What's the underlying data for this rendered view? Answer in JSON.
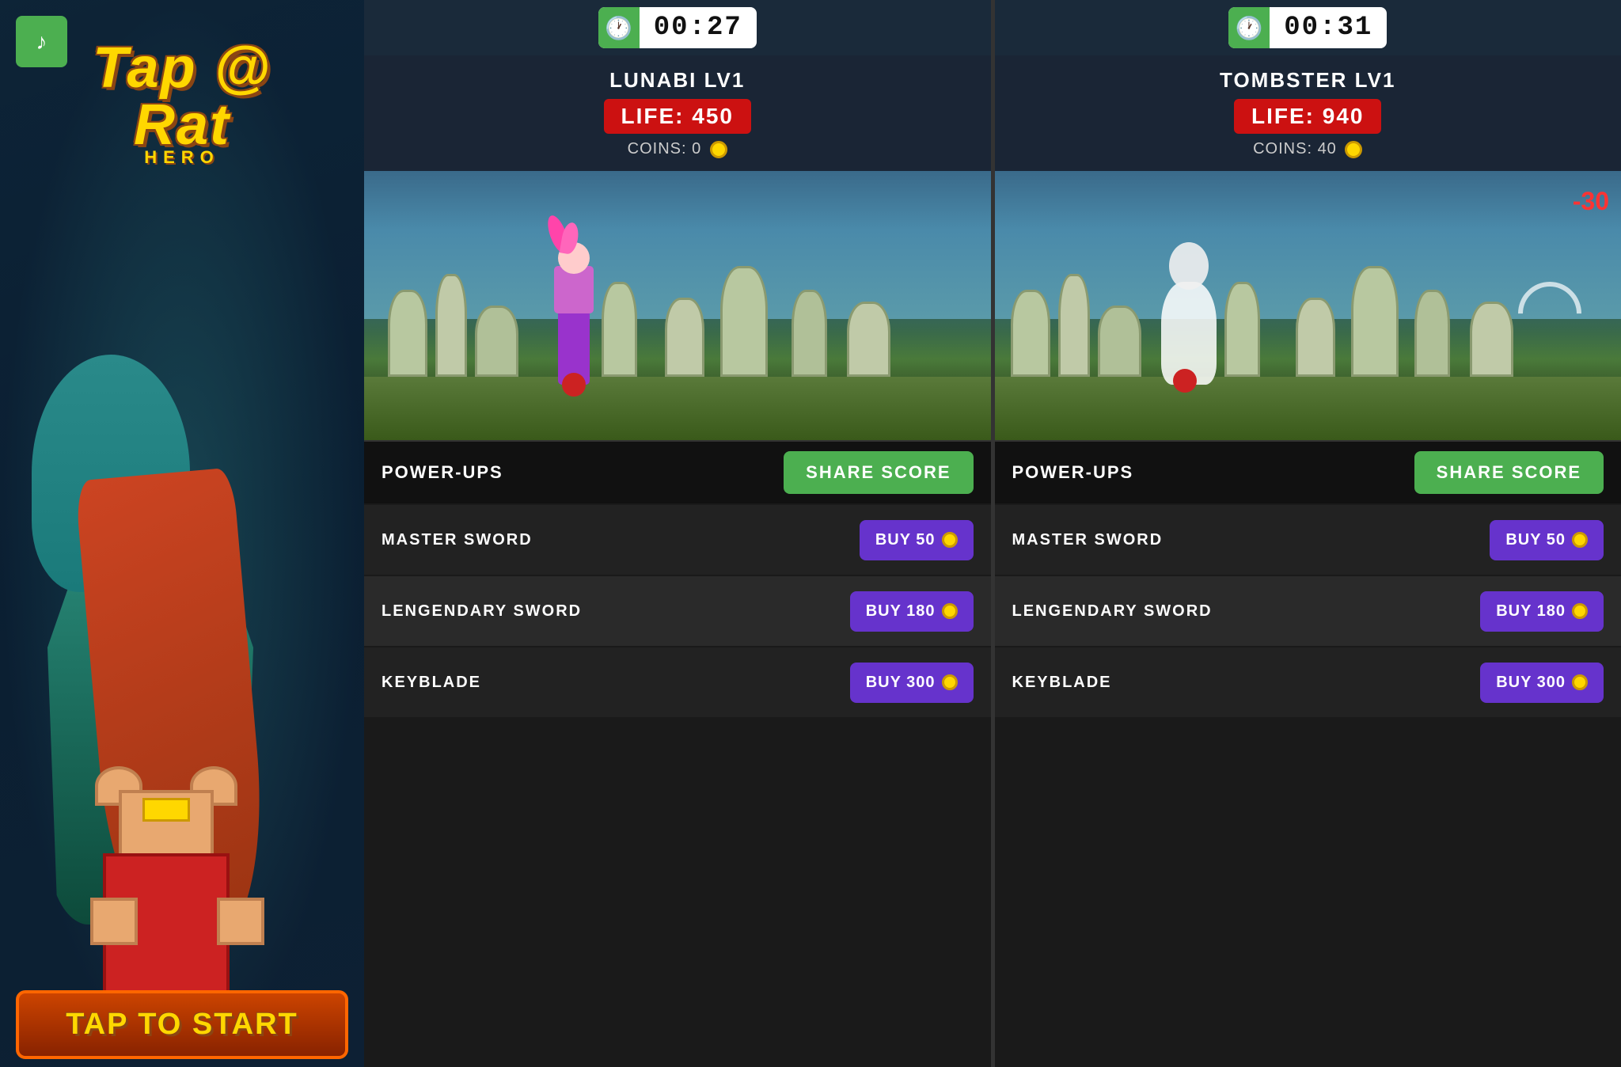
{
  "left": {
    "music_icon": "♪",
    "logo": "Tap @ Rat",
    "logo_subtitle": "HERO",
    "tap_to_start": "TAP TO START"
  },
  "panel1": {
    "timer": "00:27",
    "player_name": "LUNABI LV1",
    "life_label": "LIFE: 450",
    "coins_label": "COINS:  0",
    "power_ups_label": "POWER-UPS",
    "share_score_label": "SHARE SCORE",
    "shop_items": [
      {
        "name": "MASTER SWORD",
        "buy_label": "BUY  50"
      },
      {
        "name": "LENGENDARY SWORD",
        "buy_label": "BUY  180"
      },
      {
        "name": "KEYBLADE",
        "buy_label": "BUY  300"
      }
    ]
  },
  "panel2": {
    "timer": "00:31",
    "player_name": "TOMBSTER LV1",
    "life_label": "LIFE: 940",
    "coins_label": "COINS:  40",
    "damage_text": "-30",
    "power_ups_label": "POWER-UPS",
    "share_score_label": "SHARE SCORE",
    "shop_items": [
      {
        "name": "MASTER SWORD",
        "buy_label": "BUY  50"
      },
      {
        "name": "LENGENDARY SWORD",
        "buy_label": "BUY  180"
      },
      {
        "name": "KEYBLADE",
        "buy_label": "BUY  300"
      }
    ]
  },
  "colors": {
    "green": "#4CAF50",
    "red": "#cc1111",
    "purple": "#6633cc",
    "gold": "#FFD700",
    "timer_bg": "white"
  }
}
